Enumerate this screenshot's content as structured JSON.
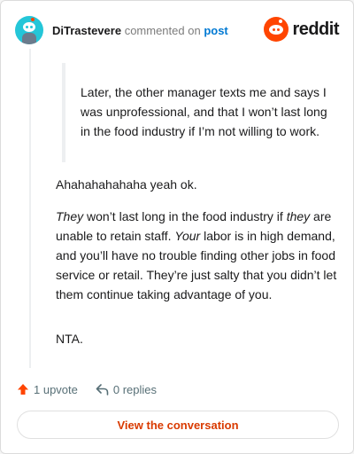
{
  "header": {
    "username": "DiTrastevere",
    "action": "commented on",
    "link": "post",
    "brand": "reddit"
  },
  "quote": "Later, the other manager texts me and says I was unprofessional, and that I won’t last long in the food industry if I’m not willing to work.",
  "comment": {
    "p1": "Ahahahahahaha yeah ok.",
    "p2": {
      "w1": "They",
      "w2": " won’t last long in the food industry if ",
      "w3": "they",
      "w4": " are unable to retain staff. ",
      "w5": "Your",
      "w6": " labor is in high demand, and you’ll have no trouble finding other jobs in food service or retail. They’re just salty that you didn’t let them continue taking advantage of you."
    },
    "p3": "NTA."
  },
  "footer": {
    "upvotes": "1 upvote",
    "replies": "0 replies"
  },
  "button": "View the conversation",
  "colors": {
    "accent": "#ff4500",
    "link": "#0079d3",
    "button_text": "#d93a00",
    "avatar": "#24c6d8"
  }
}
